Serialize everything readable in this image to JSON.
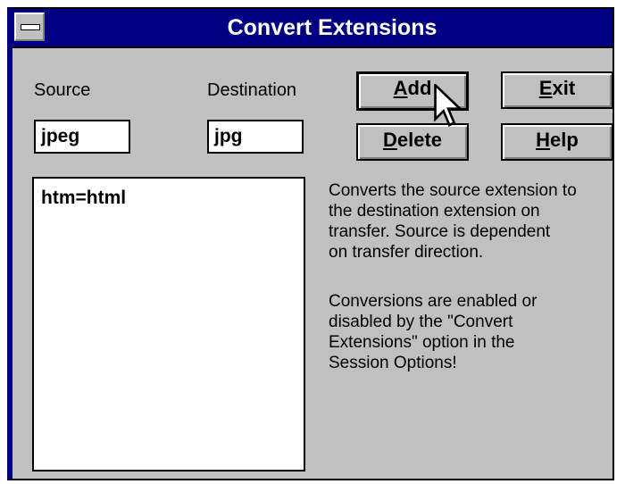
{
  "window": {
    "title": "Convert Extensions"
  },
  "labels": {
    "source": "Source",
    "destination": "Destination"
  },
  "fields": {
    "source_value": "jpeg",
    "destination_value": "jpg"
  },
  "buttons": {
    "add": "Add",
    "exit": "Exit",
    "delete": "Delete",
    "help": "Help"
  },
  "list": {
    "items": [
      "htm=html"
    ]
  },
  "description": {
    "para1_lines": [
      "Converts the source extension to",
      "the destination extension on",
      "transfer.  Source is dependent",
      "on transfer direction."
    ],
    "para2_lines": [
      "Conversions are enabled or",
      "disabled by the \"Convert",
      "Extensions\" option in the",
      "Session Options!"
    ]
  },
  "colors": {
    "title_bar": "#000080",
    "face": "#c0c0c0"
  }
}
